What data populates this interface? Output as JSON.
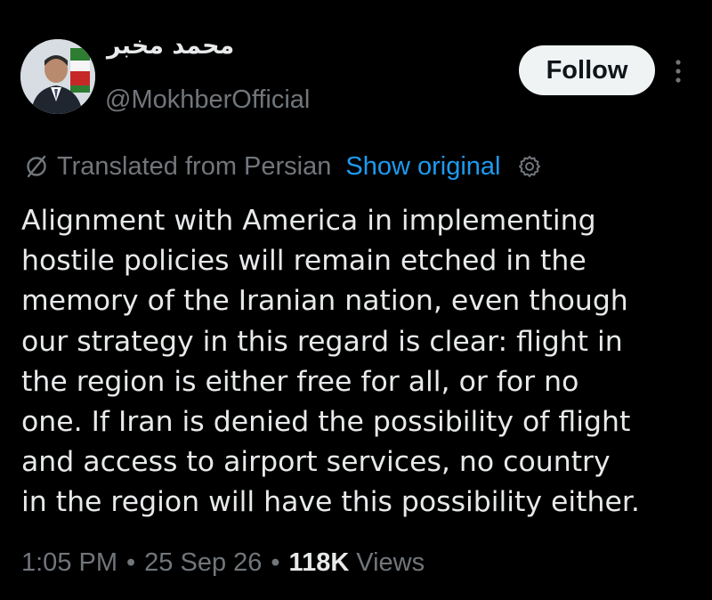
{
  "author": {
    "display_name": "محمد مخبر",
    "handle": "@MokhberOfficial",
    "follow_label": "Follow"
  },
  "translation": {
    "label": "Translated from Persian",
    "show_original_label": "Show original"
  },
  "tweet": {
    "text": "Alignment with America in implementing\nhostile policies will remain etched in the\nmemory of the Iranian nation, even though\nour strategy in this regard is clear: flight in\nthe region is either free for all, or for no\none. If Iran is denied the possibility of flight\nand access to airport services, no country\nin the region will have this possibility either."
  },
  "meta": {
    "time": "1:05 PM",
    "separator": "•",
    "date": "25 Sep 26",
    "views_count": "118K",
    "views_label": "Views"
  },
  "icons": {
    "translate": "no-translate-icon",
    "settings": "gear-icon",
    "more": "more-vertical-icon"
  },
  "colors": {
    "background": "#000000",
    "text_primary": "#e7e9ea",
    "text_secondary": "#71767b",
    "link": "#1d9bf0",
    "follow_bg": "#eff3f4",
    "follow_text": "#0f1419"
  }
}
